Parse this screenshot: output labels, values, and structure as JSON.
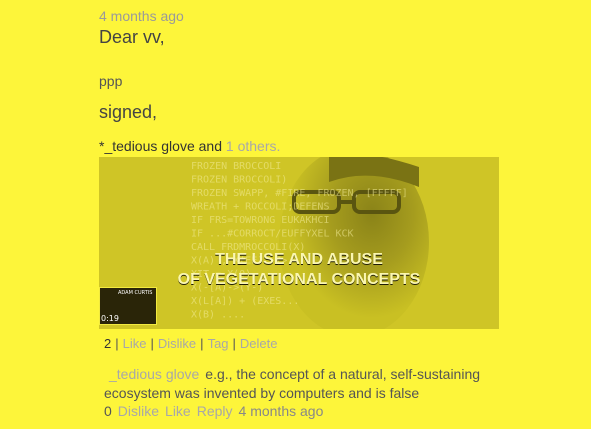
{
  "post": {
    "timestamp": "4 months ago",
    "greeting": "Dear vv,",
    "body": "ppp",
    "signoff": "signed,",
    "likers": {
      "prefix": "*_tedious glove and",
      "others_link": "1 others."
    },
    "media": {
      "title_line1": "THE USE AND ABUSE",
      "title_line2": "OF VEGETATIONAL CONCEPTS",
      "thumb_time": "0:19",
      "thumb_label": "ADAM CURTIS",
      "background_lines": [
        "FROZEN BROCCOLI",
        "FROZEN BROCCOLI)",
        "FROZEN SWAPP, #FIRE, FROZEN, [FFFFF]",
        "WREATH + ROCCOLI;DEFENS",
        "IF FRS=TOWRONG EUKAKHCI",
        "IF ...#CORROCT/EUFFYXEL KCK",
        "CALL FRDMROCCOLI(X)",
        "X(A) , X(EE) -7>",
        "XIT = X(0)",
        "X(-[A)->(Y-)",
        "X(L[A]) + (EXES...",
        "X(B) ...."
      ]
    },
    "actions": {
      "count": "2",
      "like": "Like",
      "dislike": "Dislike",
      "tag": "Tag",
      "delete": "Delete",
      "separator": "|"
    }
  },
  "comment": {
    "author": "_tedious glove",
    "text": "e.g., the concept of a natural, self-sustaining ecosystem was invented by computers and is false",
    "count": "0",
    "dislike": "Dislike",
    "like": "Like",
    "reply": "Reply",
    "timestamp": "4 months ago"
  },
  "colors": {
    "background": "#fdf53a",
    "link": "#a8a8a8",
    "media_overlay": "#d9cf2a"
  }
}
